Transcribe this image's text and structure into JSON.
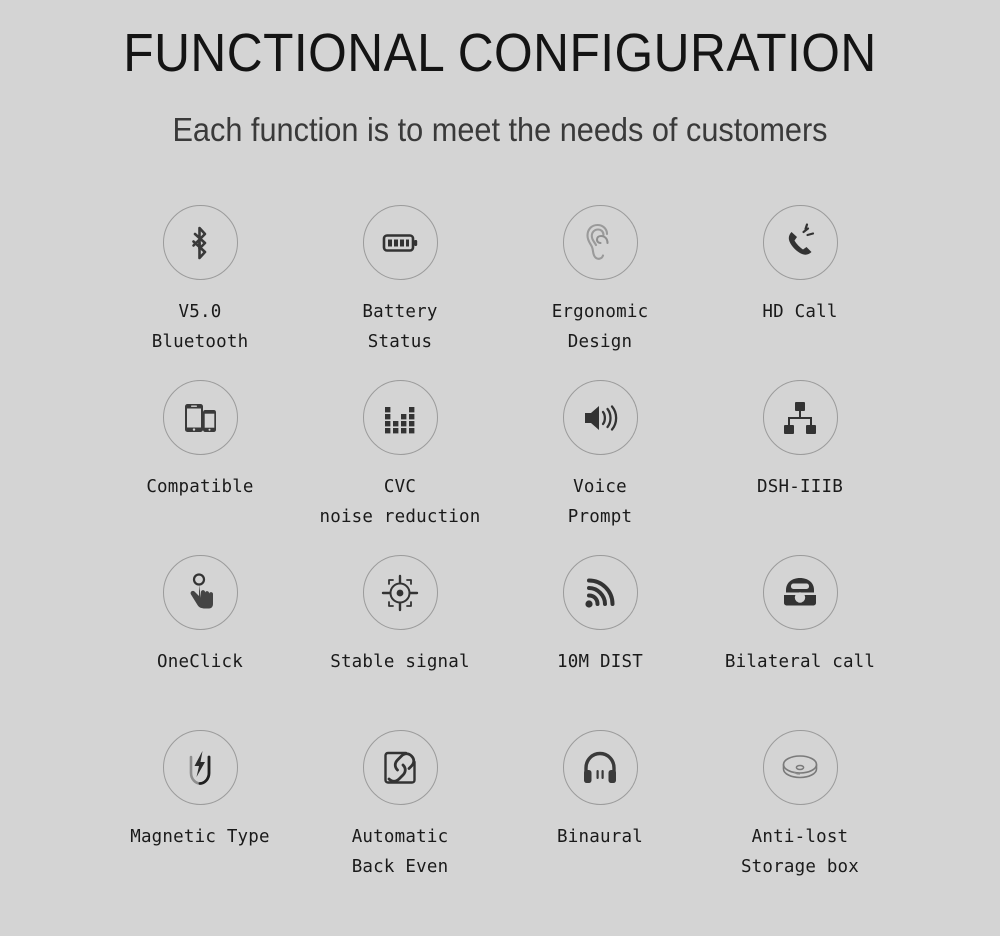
{
  "header": {
    "title": "FUNCTIONAL CONFIGURATION",
    "subtitle": "Each function is to meet the needs of customers"
  },
  "colors": {
    "background": "#d4d4d4",
    "text": "#1a1a1a",
    "title": "#141414",
    "circle_border": "#9b9b9b",
    "icon_dark": "#333333",
    "icon_outline": "#8a8a8a"
  },
  "features": [
    {
      "icon": "bluetooth-icon",
      "label": "V5.0\nBluetooth"
    },
    {
      "icon": "battery-icon",
      "label": "Battery\nStatus"
    },
    {
      "icon": "ear-icon",
      "label": "Ergonomic\nDesign"
    },
    {
      "icon": "phone-ringing-icon",
      "label": "HD Call"
    },
    {
      "icon": "two-phones-icon",
      "label": "Compatible"
    },
    {
      "icon": "equalizer-icon",
      "label": "CVC\nnoise reduction"
    },
    {
      "icon": "speaker-icon",
      "label": "Voice\nPrompt"
    },
    {
      "icon": "network-icon",
      "label": "DSH-IIIB"
    },
    {
      "icon": "tap-hand-icon",
      "label": "OneClick"
    },
    {
      "icon": "crosshair-icon",
      "label": "Stable signal"
    },
    {
      "icon": "wifi-signal-icon",
      "label": "10M DIST"
    },
    {
      "icon": "telephone-icon",
      "label": "Bilateral call"
    },
    {
      "icon": "magnet-icon",
      "label": "Magnetic Type"
    },
    {
      "icon": "link-square-icon",
      "label": "Automatic\nBack Even"
    },
    {
      "icon": "headphones-icon",
      "label": "Binaural"
    },
    {
      "icon": "charging-case-icon",
      "label": "Anti-lost\nStorage box"
    }
  ]
}
